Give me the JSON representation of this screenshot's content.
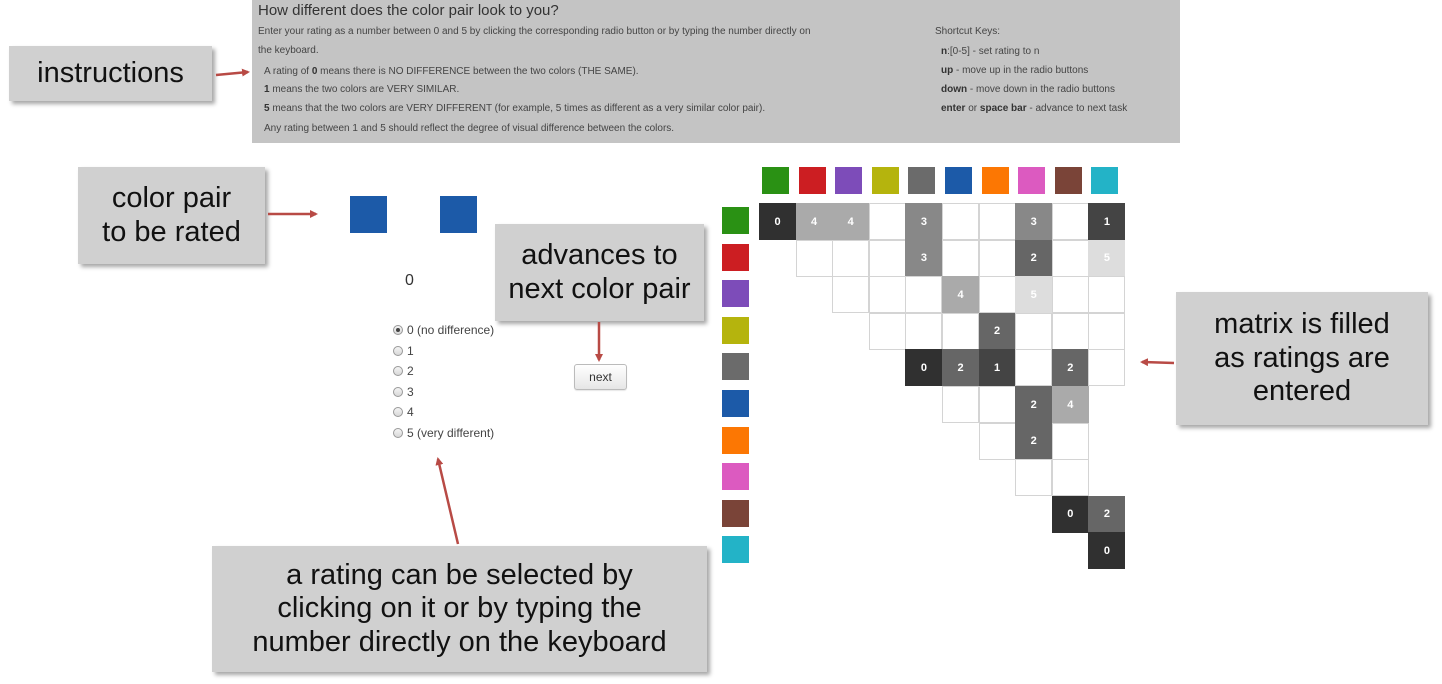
{
  "instructions": {
    "title": "How different does the color pair look to you?",
    "line1": "Enter your rating as a number between 0 and 5 by clicking the corresponding radio button or by typing the number directly on",
    "line2": "the keyboard.",
    "line3_pre": "A rating of ",
    "line3_bold": "0",
    "line3_post": " means there is NO DIFFERENCE between the two colors (THE SAME).",
    "line4_bold": "1",
    "line4_post": " means the two colors are VERY SIMILAR.",
    "line5_bold": "5",
    "line5_post": " means that the two colors are VERY DIFFERENT (for example, 5 times as different as a very similar color pair).",
    "line6": "Any rating between 1 and 5 should reflect the degree of visual difference between the colors."
  },
  "shortcuts": {
    "heading": "Shortcut Keys:",
    "k1_bold": "n",
    "k1_rest": ":[0-5] - set rating to n",
    "k2_bold": "up",
    "k2_rest": " - move up in the radio buttons",
    "k3_bold": "down",
    "k3_rest": " - move down in the radio buttons",
    "k4_bold1": "enter",
    "k4_mid": " or ",
    "k4_bold2": "space bar",
    "k4_rest": " - advance to next task"
  },
  "callouts": {
    "instructions": "instructions",
    "color_pair": "color pair\nto be rated",
    "advances": "advances to\nnext color pair",
    "matrix": "matrix is filled\nas ratings are\nentered",
    "rating": "a rating can be selected by\nclicking on it or by typing the\nnumber directly on the keyboard"
  },
  "color_pair": {
    "left": "#1c5aa8",
    "right": "#1c5aa8"
  },
  "rating": {
    "current": "0",
    "options": [
      {
        "label": "0 (no difference)",
        "checked": true
      },
      {
        "label": "1",
        "checked": false
      },
      {
        "label": "2",
        "checked": false
      },
      {
        "label": "3",
        "checked": false
      },
      {
        "label": "4",
        "checked": false
      },
      {
        "label": "5 (very different)",
        "checked": false
      }
    ]
  },
  "next_label": "next",
  "matrix": {
    "colors": [
      "#2a9114",
      "#cc1e22",
      "#7d4cb9",
      "#b5b40d",
      "#6b6b6b",
      "#1c5aa8",
      "#fc7703",
      "#dc5ac0",
      "#7a4438",
      "#23b3c7"
    ],
    "values": [
      [
        0,
        4,
        4,
        null,
        3,
        null,
        null,
        3,
        null,
        1
      ],
      [
        null,
        null,
        null,
        3,
        null,
        null,
        2,
        null,
        5
      ],
      [
        null,
        null,
        null,
        4,
        null,
        5,
        null,
        null
      ],
      [
        null,
        null,
        null,
        2,
        null,
        null,
        null
      ],
      [
        0,
        2,
        1,
        null,
        2,
        null
      ],
      [
        null,
        null,
        2,
        4
      ],
      [
        null,
        2,
        null
      ],
      [
        null,
        null
      ],
      [
        0,
        2
      ],
      [
        0
      ]
    ]
  }
}
